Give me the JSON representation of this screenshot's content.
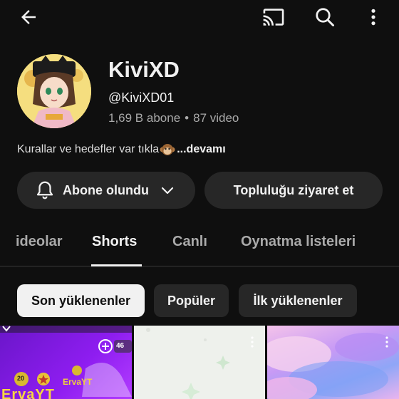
{
  "topbar": {
    "back_icon": "arrow-left-icon",
    "cast_icon": "cast-icon",
    "search_icon": "search-icon",
    "more_icon": "more-vert-icon"
  },
  "channel": {
    "name": "KiviXD",
    "handle": "@KiviXD01",
    "subscribers": "1,69 B abone",
    "separator": "•",
    "videos": "87 video",
    "description": "Kurallar ve hedefler var tıkla",
    "description_emoji": "monkey-face-icon",
    "more_label": "...devamı"
  },
  "actions": {
    "subscribed_label": "Abone olundu",
    "visit_community_label": "Topluluğu ziyaret et"
  },
  "tabs": [
    {
      "label": "ideolar",
      "active": false
    },
    {
      "label": "Shorts",
      "active": true
    },
    {
      "label": "Canlı",
      "active": false
    },
    {
      "label": "Oynatma listeleri",
      "active": false
    }
  ],
  "filters": [
    {
      "label": "Son yüklenenler",
      "selected": true
    },
    {
      "label": "Popüler",
      "selected": false
    },
    {
      "label": "İlk yüklenenler",
      "selected": false
    }
  ],
  "thumbnails": [
    {
      "label_1": "ErvaYT",
      "label_2": "ErvaYT",
      "badge": "20",
      "count": "46"
    },
    {
      "label_1": ""
    },
    {
      "label_1": ""
    }
  ],
  "colors": {
    "background": "#0f0f0f",
    "button_bg": "#272727",
    "text_primary": "#f1f1f1",
    "text_secondary": "#aaaaaa"
  }
}
